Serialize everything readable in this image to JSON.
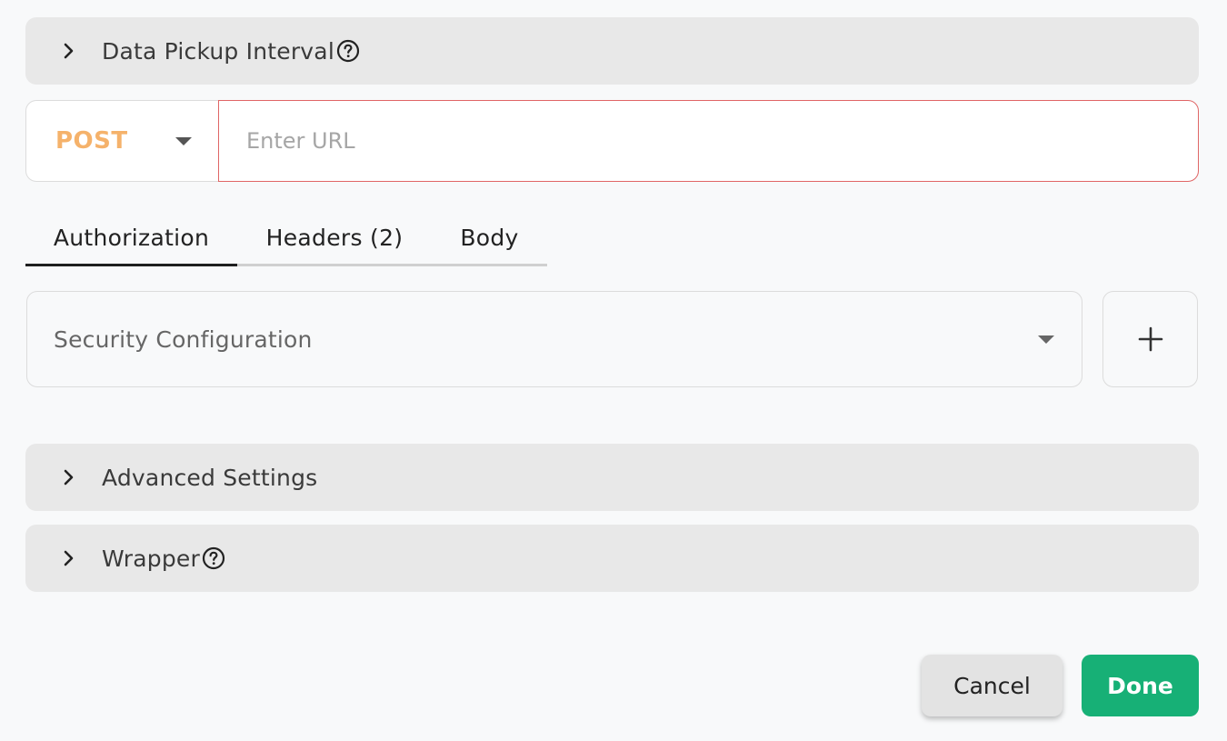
{
  "accordions": {
    "data_pickup": {
      "title": "Data Pickup Interval",
      "has_help": true
    },
    "advanced": {
      "title": "Advanced Settings",
      "has_help": false
    },
    "wrapper": {
      "title": "Wrapper",
      "has_help": true
    }
  },
  "request": {
    "method": "POST",
    "url_value": "",
    "url_placeholder": "Enter URL"
  },
  "tabs": [
    {
      "label": "Authorization",
      "active": true
    },
    {
      "label": "Headers (2)",
      "active": false
    },
    {
      "label": "Body",
      "active": false
    }
  ],
  "security": {
    "placeholder": "Security Configuration"
  },
  "footer": {
    "cancel_label": "Cancel",
    "done_label": "Done"
  },
  "colors": {
    "method": "#f5b26b",
    "url_border_error": "#e06666",
    "done_bg": "#17b076",
    "accordion_bg": "#e8e8e8",
    "page_bg": "#f8f9fa"
  },
  "icons": {
    "accordion_toggle": "chevron-right-icon",
    "help": "help-circle-icon",
    "dropdown": "caret-down-icon",
    "add": "plus-icon"
  }
}
